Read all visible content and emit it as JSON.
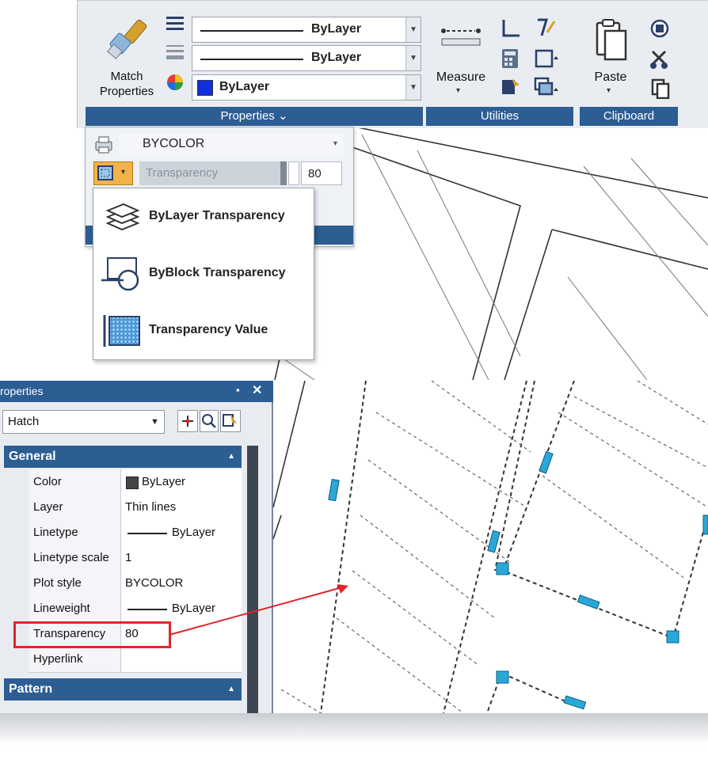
{
  "ribbon": {
    "match_properties_label": "Match\nProperties",
    "linetype_value": "ByLayer",
    "lineweight_value": "ByLayer",
    "color_value": "ByLayer",
    "properties_panel_title": "Properties  ⌄",
    "measure_label": "Measure",
    "utilities_panel_title": "Utilities",
    "paste_label": "Paste",
    "clipboard_panel_title": "Clipboard"
  },
  "expanded": {
    "plot_style_value": "BYCOLOR",
    "transparency_label": "Transparency",
    "transparency_value": "80"
  },
  "menu": {
    "items": [
      {
        "label": "ByLayer Transparency"
      },
      {
        "label": "ByBlock Transparency"
      },
      {
        "label": "Transparency Value"
      }
    ]
  },
  "properties_palette": {
    "title": "roperties",
    "selection": "Hatch",
    "general_section": "General",
    "pattern_section": "Pattern",
    "rows": [
      {
        "key": "Color",
        "value": "ByLayer"
      },
      {
        "key": "Layer",
        "value": "Thin lines"
      },
      {
        "key": "Linetype",
        "value": "ByLayer"
      },
      {
        "key": "Linetype scale",
        "value": "1"
      },
      {
        "key": "Plot style",
        "value": "BYCOLOR"
      },
      {
        "key": "Lineweight",
        "value": "ByLayer"
      },
      {
        "key": "Transparency",
        "value": "80"
      },
      {
        "key": "Hyperlink",
        "value": ""
      }
    ]
  },
  "colors": {
    "accent": "#2c5d93",
    "grip": "#29a8d8",
    "highlight": "#e0262b"
  }
}
